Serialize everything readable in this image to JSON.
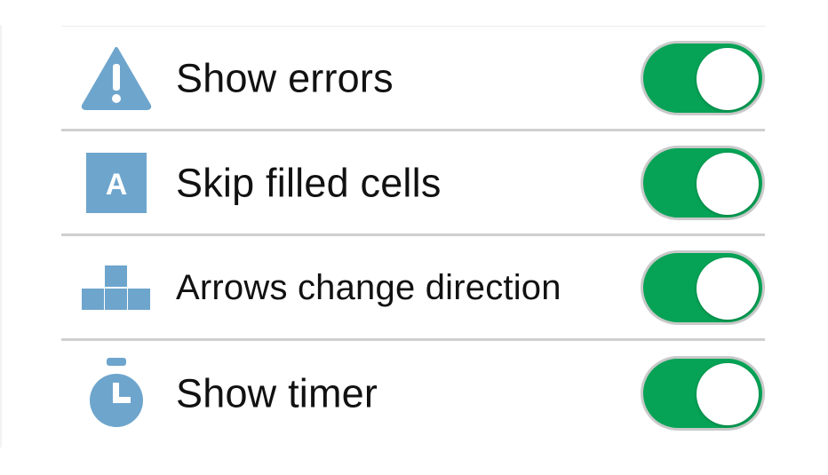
{
  "colors": {
    "accent_icon": "#6ea5cd",
    "toggle_on": "#06a356"
  },
  "settings": [
    {
      "label": "Show errors",
      "icon": "warning-triangle-icon",
      "enabled": true
    },
    {
      "label": "Skip filled cells",
      "icon": "letter-a-tile-icon",
      "enabled": true,
      "icon_text": "A"
    },
    {
      "label": "Arrows change direction",
      "icon": "stacked-blocks-icon",
      "enabled": true
    },
    {
      "label": "Show timer",
      "icon": "stopwatch-icon",
      "enabled": true
    }
  ]
}
